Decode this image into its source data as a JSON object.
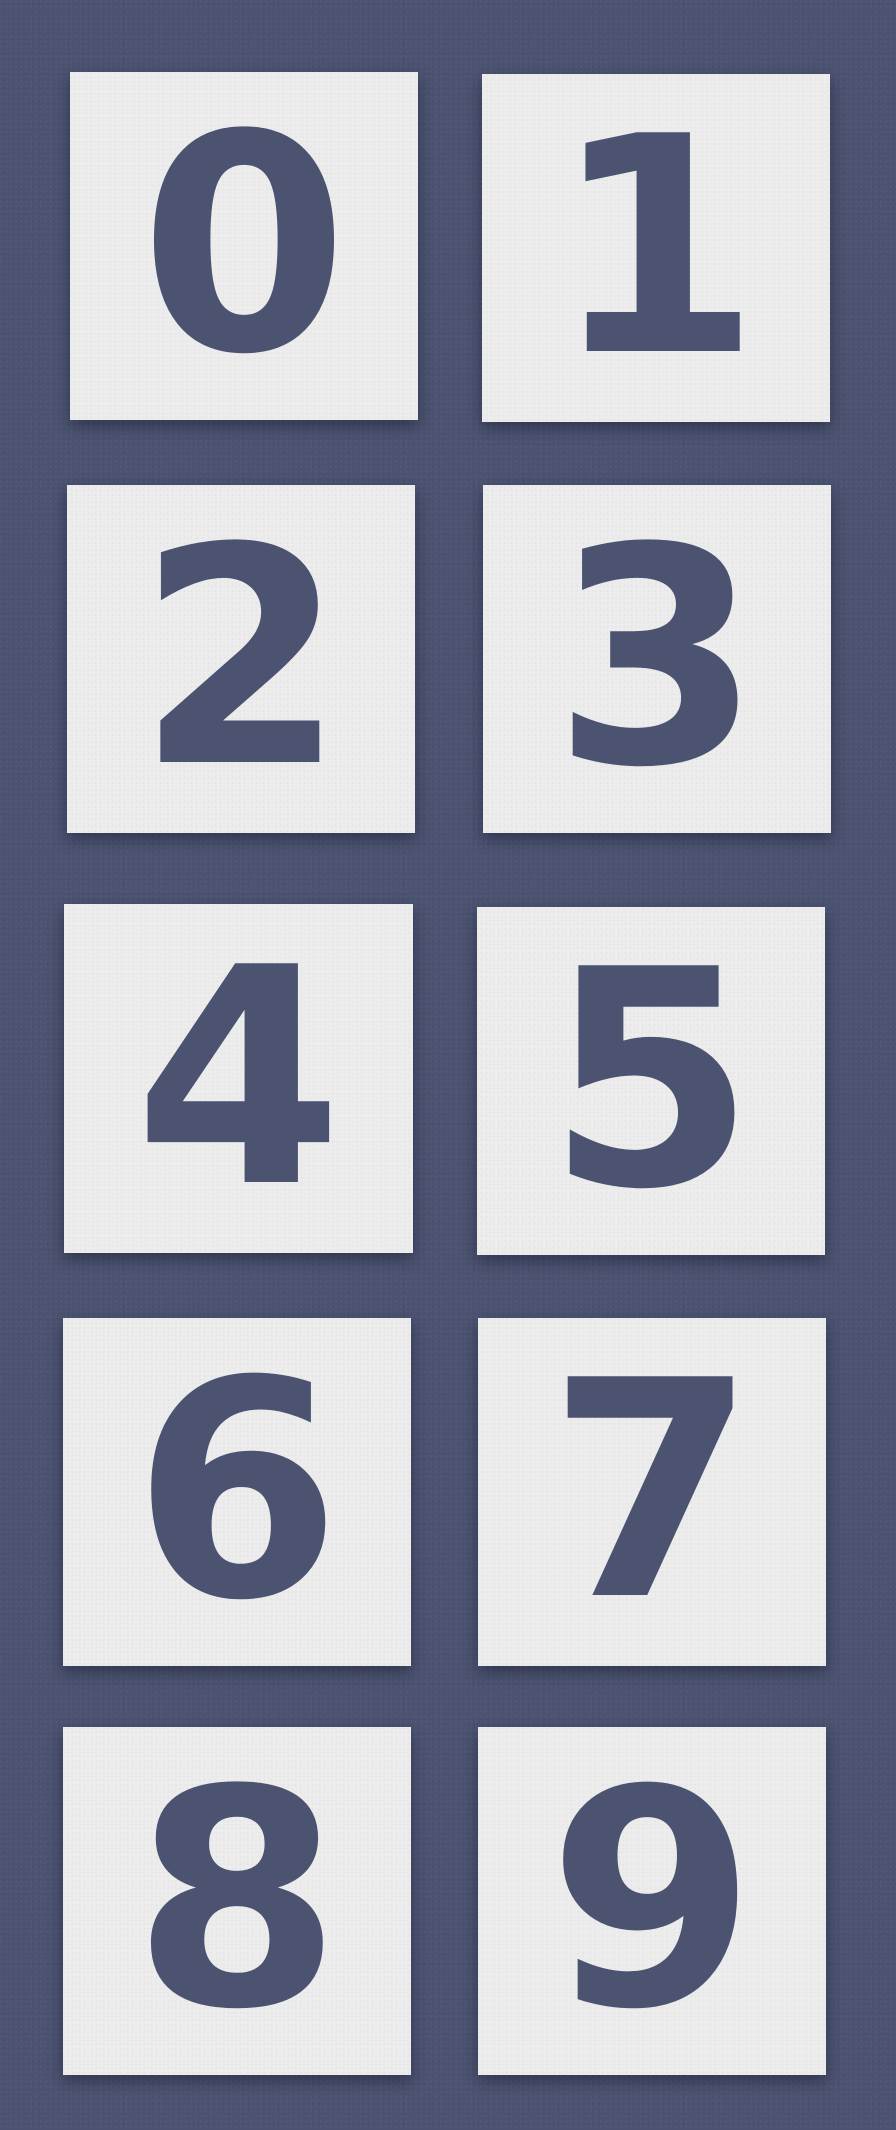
{
  "tiles": [
    {
      "digit": "0"
    },
    {
      "digit": "1"
    },
    {
      "digit": "2"
    },
    {
      "digit": "3"
    },
    {
      "digit": "4"
    },
    {
      "digit": "5"
    },
    {
      "digit": "6"
    },
    {
      "digit": "7"
    },
    {
      "digit": "8"
    },
    {
      "digit": "9"
    }
  ],
  "colors": {
    "background": "#4b5371",
    "tile": "#ededee",
    "digit": "#4b5371"
  }
}
